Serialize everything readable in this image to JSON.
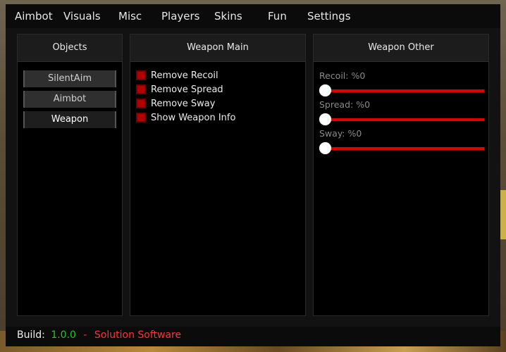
{
  "menu": [
    {
      "label": "Aimbot"
    },
    {
      "label": "Visuals"
    },
    {
      "label": "Misc"
    },
    {
      "label": "Players"
    },
    {
      "label": "Skins"
    },
    {
      "label": "Fun"
    },
    {
      "label": "Settings"
    }
  ],
  "objects_panel": {
    "title": "Objects",
    "items": [
      {
        "label": "SilentAim",
        "active": false
      },
      {
        "label": "Aimbot",
        "active": false
      },
      {
        "label": "Weapon",
        "active": true
      }
    ]
  },
  "weapon_main": {
    "title": "Weapon Main",
    "options": [
      {
        "label": "Remove Recoil",
        "checked": true
      },
      {
        "label": "Remove Spread",
        "checked": true
      },
      {
        "label": "Remove Sway",
        "checked": true
      },
      {
        "label": "Show Weapon Info",
        "checked": true
      }
    ]
  },
  "weapon_other": {
    "title": "Weapon Other",
    "sliders": [
      {
        "label": "Recoil: %0",
        "value": 0
      },
      {
        "label": "Spread: %0",
        "value": 0
      },
      {
        "label": "Sway: %0",
        "value": 0
      }
    ]
  },
  "footer": {
    "build_label": "Build:",
    "version": "1.0.0",
    "separator": "-",
    "company": "Solution Software"
  },
  "colors": {
    "accent_red": "#e00000",
    "version_green": "#22c722",
    "company_red": "#ff3333"
  }
}
